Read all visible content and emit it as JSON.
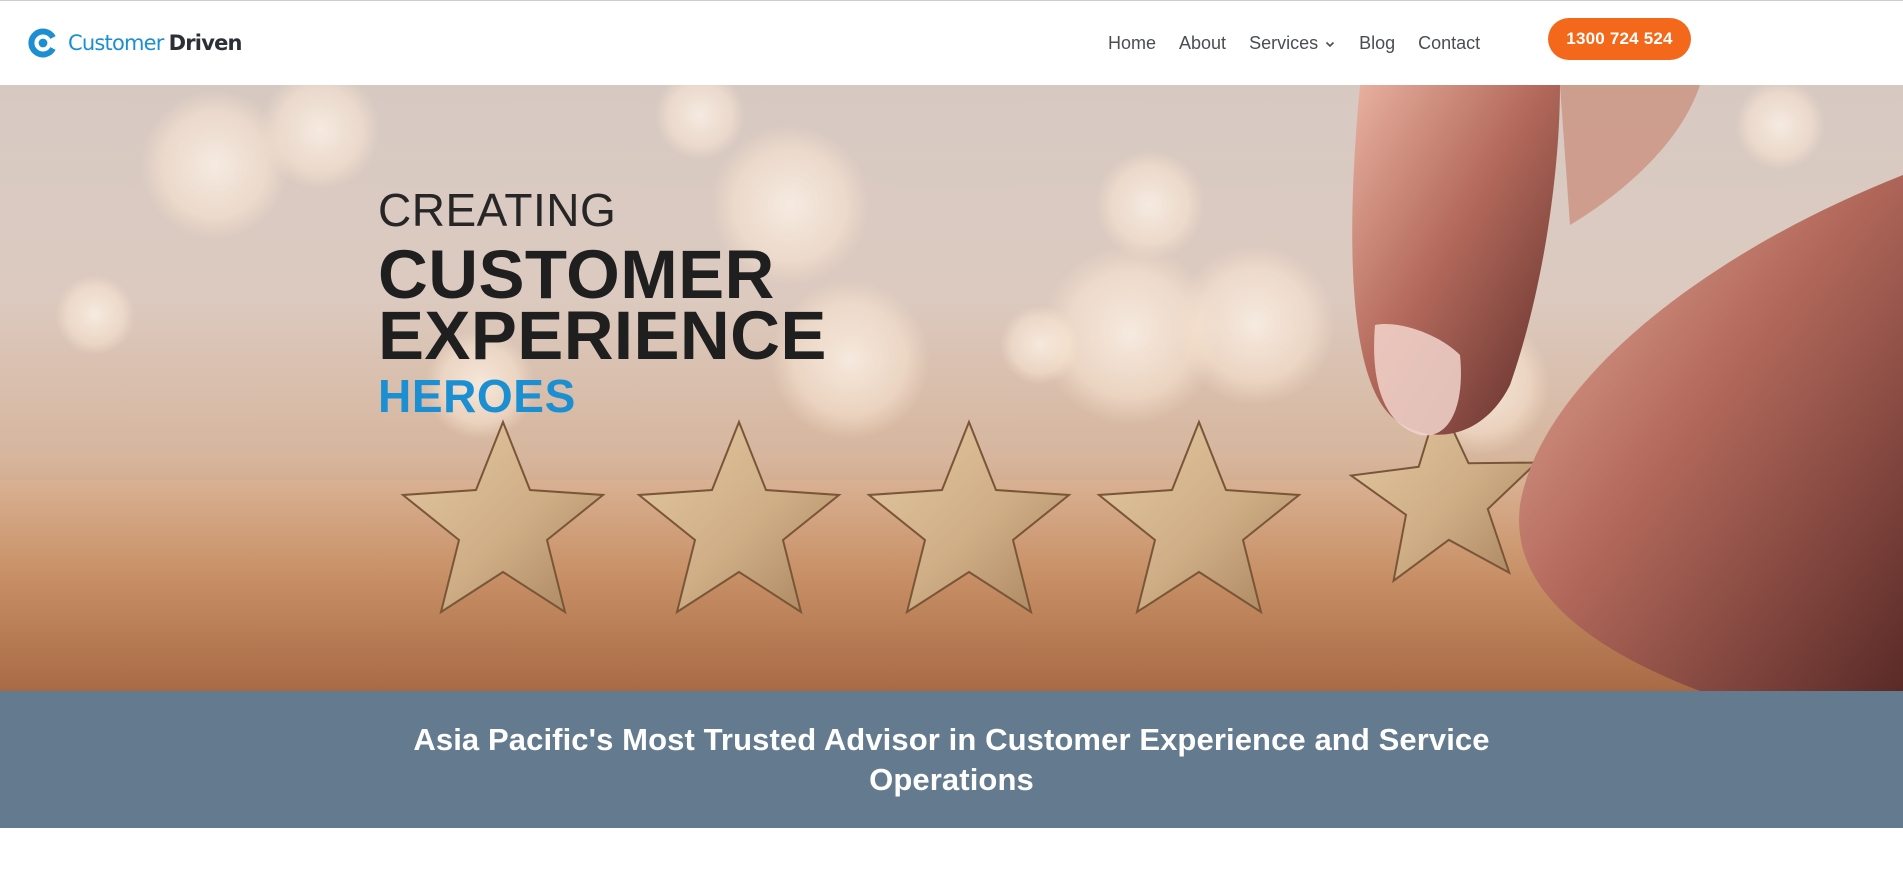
{
  "brand": {
    "name_part1": "Customer",
    "name_part2": "Driven",
    "primary_color": "#1b8fd1",
    "accent_color": "#f4681c"
  },
  "nav": {
    "items": [
      {
        "label": "Home"
      },
      {
        "label": "About"
      },
      {
        "label": "Services",
        "has_dropdown": true
      },
      {
        "label": "Blog"
      },
      {
        "label": "Contact"
      }
    ],
    "phone_label": "1300 724 524"
  },
  "hero": {
    "line1": "CREATING",
    "line2": "CUSTOMER",
    "line3": "EXPERIENCE",
    "line4": "HEROES",
    "image_description_icon": "five-wooden-stars-rating"
  },
  "banner": {
    "title": "Asia Pacific's Most Trusted Advisor in Customer Experience and Service Operations",
    "background_color": "#647b8f"
  }
}
